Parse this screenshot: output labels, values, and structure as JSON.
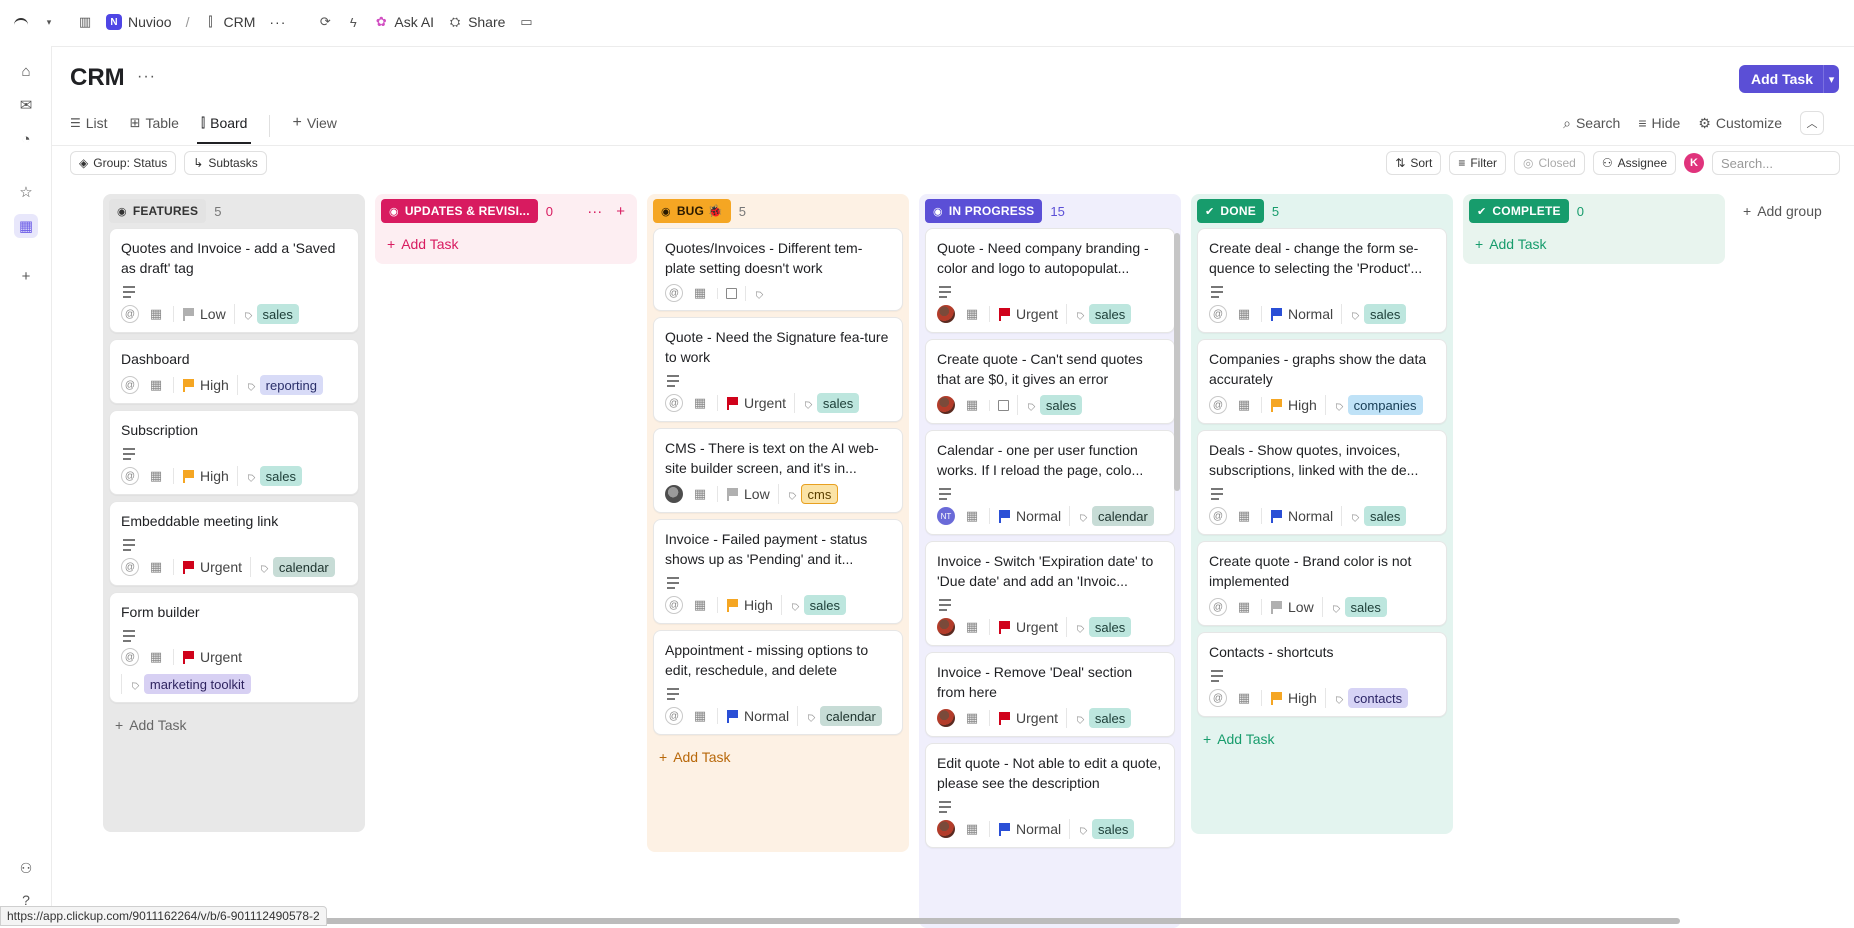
{
  "topbar": {
    "workspace_initial": "N",
    "workspace_name": "Nuvioo",
    "separator": "/",
    "space_name": "CRM",
    "more": "···",
    "ask_ai": "Ask AI",
    "share": "Share"
  },
  "page": {
    "title": "CRM",
    "more": "···",
    "add_task_label": "Add Task"
  },
  "view_tabs": [
    {
      "label": "List"
    },
    {
      "label": "Table"
    },
    {
      "label": "Board"
    },
    {
      "label": "View"
    }
  ],
  "right_tools": {
    "search": "Search",
    "hide": "Hide",
    "customize": "Customize"
  },
  "filters_left": {
    "group": "Group: Status",
    "subtasks": "Subtasks"
  },
  "filters_right": {
    "sort": "Sort",
    "filter": "Filter",
    "closed": "Closed",
    "assignee": "Assignee",
    "avatar_initial": "K",
    "search_placeholder": "Search..."
  },
  "columns": [
    {
      "status": "FEATURES",
      "count": "5",
      "color": "#e8e8e8",
      "pill_bg": "#e3e3e3",
      "pill_fg": "#333333",
      "add_task": "Add Task",
      "cards": [
        {
          "title": "Quotes and Invoice - add a 'Saved as draft' tag",
          "desc": true,
          "priority": "Low",
          "priority_color": "#b0b0b0",
          "tag": "sales",
          "tag_class": "sales"
        },
        {
          "title": "Dashboard",
          "desc": false,
          "priority": "High",
          "priority_color": "#f5a623",
          "tag": "reporting",
          "tag_class": "reporting"
        },
        {
          "title": "Subscription",
          "desc": true,
          "priority": "High",
          "priority_color": "#f5a623",
          "tag": "sales",
          "tag_class": "sales"
        },
        {
          "title": "Embeddable meeting link",
          "desc": true,
          "priority": "Urgent",
          "priority_color": "#d0021b",
          "tag": "calendar",
          "tag_class": "calendar"
        },
        {
          "title": "Form builder",
          "desc": true,
          "priority": "Urgent",
          "priority_color": "#d0021b",
          "tag": "marketing toolkit",
          "tag_class": "marketing"
        }
      ]
    },
    {
      "status": "UPDATES & REVISI...",
      "count": "0",
      "color": "#fdeef2",
      "pill_bg": "#d81b60",
      "pill_fg": "#ffffff",
      "add_task": "Add Task",
      "cards": []
    },
    {
      "status": "BUG 🐞",
      "count": "5",
      "color": "#fdf1e4",
      "pill_bg": "#f5a623",
      "pill_fg": "#2a1a00",
      "add_task": "Add Task",
      "cards": [
        {
          "title": "Quotes/Invoices - Different tem-plate setting doesn't work",
          "desc": false,
          "priority": "",
          "tag": ""
        },
        {
          "title": "Quote - Need the Signature fea-ture to work",
          "desc": true,
          "priority": "Urgent",
          "priority_color": "#d0021b",
          "tag": "sales",
          "tag_class": "sales"
        },
        {
          "title": "CMS - There is text on the AI web-site builder screen, and it's in...",
          "desc": false,
          "avatar": "gray",
          "priority": "Low",
          "priority_color": "#b0b0b0",
          "tag": "cms",
          "tag_class": "cms"
        },
        {
          "title": "Invoice - Failed payment - status shows up as 'Pending' and it...",
          "desc": true,
          "priority": "High",
          "priority_color": "#f5a623",
          "tag": "sales",
          "tag_class": "sales"
        },
        {
          "title": "Appointment - missing options to edit, reschedule, and delete",
          "desc": true,
          "priority": "Normal",
          "priority_color": "#2a4fd6",
          "tag": "calendar",
          "tag_class": "calendar"
        }
      ]
    },
    {
      "status": "IN PROGRESS",
      "count": "15",
      "color": "#f0effc",
      "pill_bg": "#5b4fd6",
      "pill_fg": "#ffffff",
      "cards": [
        {
          "title": "Quote - Need company branding - color and logo to autopopulat...",
          "desc": true,
          "avatar": "user",
          "priority": "Urgent",
          "priority_color": "#d0021b",
          "tag": "sales",
          "tag_class": "sales"
        },
        {
          "title": "Create quote - Can't send quotes that are $0, it gives an error",
          "desc": false,
          "avatar": "user",
          "priority": "",
          "tag": "sales",
          "tag_class": "sales"
        },
        {
          "title": "Calendar - one per user function works. If I reload the page, colo...",
          "desc": true,
          "avatar": "nt",
          "avatar_text": "NT",
          "priority": "Normal",
          "priority_color": "#2a4fd6",
          "tag": "calendar",
          "tag_class": "calendar"
        },
        {
          "title": "Invoice - Switch 'Expiration date' to 'Due date' and add an 'Invoic...",
          "desc": true,
          "avatar": "user",
          "priority": "Urgent",
          "priority_color": "#d0021b",
          "tag": "sales",
          "tag_class": "sales"
        },
        {
          "title": "Invoice - Remove 'Deal' section from here",
          "desc": false,
          "avatar": "user",
          "priority": "Urgent",
          "priority_color": "#d0021b",
          "tag": "sales",
          "tag_class": "sales"
        },
        {
          "title": "Edit quote - Not able to edit a quote, please see the description",
          "desc": true,
          "avatar": "user",
          "priority": "Normal",
          "priority_color": "#2a4fd6",
          "tag": "sales",
          "tag_class": "sales"
        }
      ]
    },
    {
      "status": "DONE",
      "count": "5",
      "color": "#e3f4ef",
      "pill_bg": "#179c6c",
      "pill_fg": "#ffffff",
      "add_task": "Add Task",
      "cards": [
        {
          "title": "Create deal - change the form se-quence to selecting the 'Product'...",
          "desc": true,
          "priority": "Normal",
          "priority_color": "#2a4fd6",
          "tag": "sales",
          "tag_class": "sales"
        },
        {
          "title": "Companies - graphs show the data accurately",
          "desc": false,
          "priority": "High",
          "priority_color": "#f5a623",
          "tag": "companies",
          "tag_class": "companies"
        },
        {
          "title": "Deals - Show quotes, invoices, subscriptions, linked with the de...",
          "desc": true,
          "priority": "Normal",
          "priority_color": "#2a4fd6",
          "tag": "sales",
          "tag_class": "sales"
        },
        {
          "title": "Create quote - Brand color is not implemented",
          "desc": false,
          "priority": "Low",
          "priority_color": "#b0b0b0",
          "tag": "sales",
          "tag_class": "sales"
        },
        {
          "title": "Contacts - shortcuts",
          "desc": true,
          "priority": "High",
          "priority_color": "#f5a623",
          "tag": "contacts",
          "tag_class": "contacts"
        }
      ]
    },
    {
      "status": "COMPLETE",
      "count": "0",
      "color": "#e8f4ee",
      "pill_bg": "#179c6c",
      "pill_fg": "#ffffff",
      "add_task": "Add Task",
      "cards": []
    }
  ],
  "add_group": "Add group",
  "status_url": "https://app.clickup.com/9011162264/v/b/6-901112490578-2"
}
